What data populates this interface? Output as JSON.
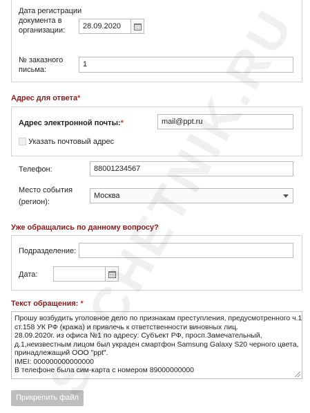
{
  "doc_info": {
    "reg_date_label": "Дата регистрации документа в организации:",
    "reg_date_value": "28.09.2020",
    "letter_no_label": "№ заказного письма:",
    "letter_no_value": "1"
  },
  "reply_address": {
    "section_title": "Адрес для ответа",
    "required_mark": "*",
    "email_label": "Адрес электронной почты:",
    "email_required": "*",
    "email_value": "mail@ppt.ru",
    "postal_checkbox_label": "Указать почтовый адрес",
    "postal_checked": false
  },
  "phone": {
    "label": "Телефон:",
    "value": "88001234567"
  },
  "region": {
    "label_line1": "Место события",
    "label_line2": "(регион):",
    "value": "Москва"
  },
  "previous_appeal": {
    "section_title": "Уже обращались по данному вопросу?",
    "dept_label": "Подразделение:",
    "dept_value": "",
    "date_label": "Дата:",
    "date_value": ""
  },
  "appeal_text": {
    "section_title": "Текст обращения:",
    "required_mark": "*",
    "lines": [
      "Прошу возбудить уголовное дело по признакам преступления, предусмотренного ч.1",
      "ст.158 УК РФ (кража) и привлечь к ответственности виновных лиц.",
      "28.09.2020г. из офиса №1 по адресу: Субъект РФ, просп.Замечательный,",
      "д.1,неизвестным лицом был украден смартфон Samsung Galaxy S20 черного цвета,",
      "принадлежащий ООО \"ppt\".",
      "IMEI: 000000000000000",
      "В телефоне была сим-карта с номером 89000000000"
    ]
  },
  "attach_button": {
    "label": "Прикрепить файл"
  },
  "watermark": {
    "text": "SUCHETNIK.RU"
  },
  "colors": {
    "section_title": "#8b1a1a",
    "required": "#c0392b",
    "button_bg": "#bdbdbd",
    "border": "#b9b9b9"
  },
  "icons": {
    "calendar": "calendar-icon",
    "dropdown": "chevron-down-icon"
  }
}
